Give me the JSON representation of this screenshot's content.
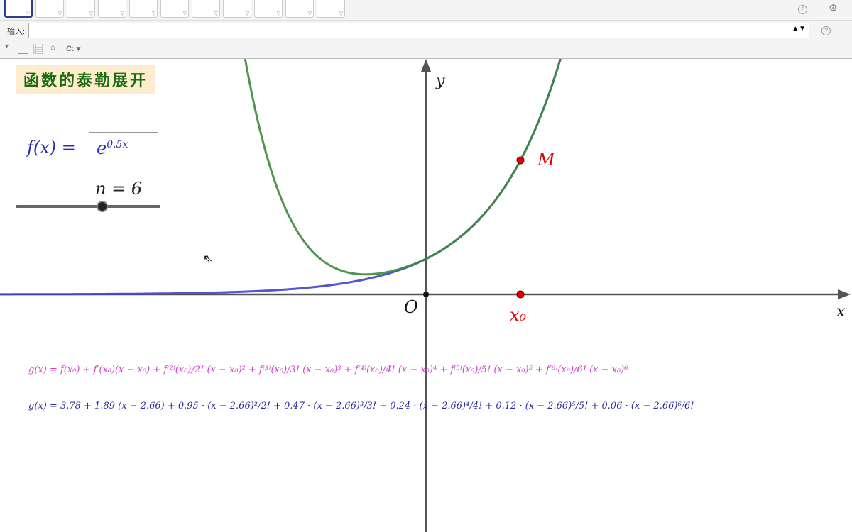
{
  "toolbar": {
    "tools": [
      "move",
      "point",
      "line",
      "perpendicular",
      "polygon",
      "circle-center",
      "circle-3pts",
      "angle",
      "reflect",
      "slider",
      "move-graphics"
    ],
    "help_icon": "help-icon",
    "settings_icon": "gear-icon"
  },
  "input_bar": {
    "label": "输入:",
    "value": "",
    "placeholder": ""
  },
  "style_bar": {
    "graphics_label": "C:"
  },
  "graphics": {
    "title": "函数的泰勒展开",
    "f_label": "f(x) =",
    "f_expr_base": "e",
    "f_expr_exp": "0.5x",
    "n_label": "n = 6",
    "n": 6,
    "n_min": 0,
    "n_max": 10,
    "x0": 2.66,
    "axis_x": "x",
    "axis_y": "y",
    "origin": "O",
    "point_M": "M",
    "point_x0": "x₀",
    "formula_general": "g(x) = f(x₀) + f′(x₀)(x − x₀) + f⁽²⁾(x₀)/2! (x − x₀)² + f⁽³⁾(x₀)/3! (x − x₀)³ + f⁽⁴⁾(x₀)/4! (x − x₀)⁴ + f⁽⁵⁾(x₀)/5! (x − x₀)⁵ + f⁽⁶⁾(x₀)/6! (x − x₀)⁶",
    "formula_numeric": "g(x) =  3.78 + 1.89 (x − 2.66) + 0.95 · (x − 2.66)²/2! + 0.47 · (x − 2.66)³/3! + 0.24 · (x − 2.66)⁴/4! + 0.12 · (x − 2.66)⁵/5! + 0.06 · (x − 2.66)⁶/6!",
    "colors": {
      "f_curve": "#4040d0",
      "taylor_curve": "#3c8a3c",
      "point": "#e00000",
      "formula": "#d040d0",
      "formula_numeric": "#2b2b9a"
    }
  }
}
